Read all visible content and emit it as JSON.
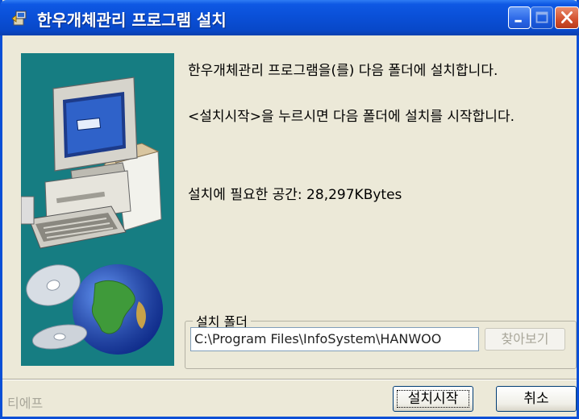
{
  "window": {
    "title": "한우개체관리 프로그램 설치"
  },
  "content": {
    "line1": "한우개체관리 프로그램을(를) 다음 폴더에 설치합니다.",
    "line2": "<설치시작>을 누르시면 다음 폴더에 설치를 시작합니다.",
    "space_required": "설치에 필요한 공간: 28,297KBytes"
  },
  "folder_group": {
    "label": "설치 폴더",
    "path": "C:\\Program Files\\InfoSystem\\HANWOO",
    "browse_label": "찾아보기"
  },
  "footer": {
    "brand": "티에프",
    "install_label": "설치시작",
    "cancel_label": "취소"
  },
  "icons": [
    "setup-app-icon",
    "minimize-icon",
    "maximize-icon",
    "close-icon",
    "computer-illustration",
    "cd-globe-illustration"
  ],
  "colors": {
    "titlebar": "#0a4fd6",
    "side_panel": "#167d82",
    "window_bg": "#ece9d8"
  }
}
